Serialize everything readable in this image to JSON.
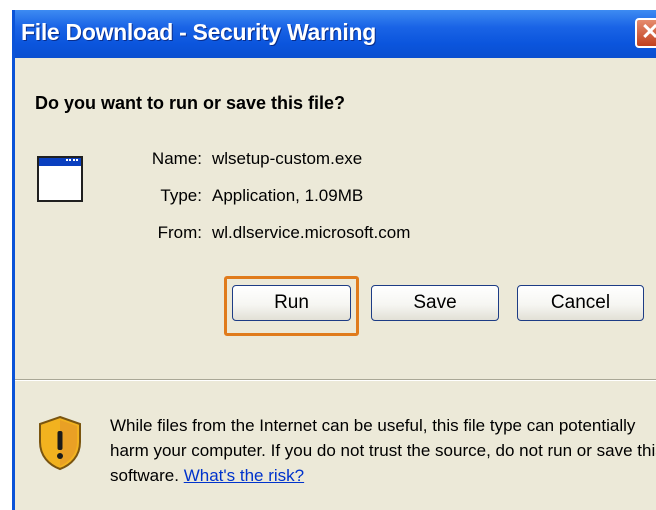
{
  "window": {
    "title": "File Download - Security Warning",
    "question": "Do you want to run or save this file?"
  },
  "file": {
    "name_label": "Name:",
    "name_value": "wlsetup-custom.exe",
    "type_label": "Type:",
    "type_value": "Application, 1.09MB",
    "from_label": "From:",
    "from_value": "wl.dlservice.microsoft.com"
  },
  "buttons": {
    "run": "Run",
    "save": "Save",
    "cancel": "Cancel"
  },
  "warning": {
    "text": "While files from the Internet can be useful, this file type can potentially harm your computer. If you do not trust the source, do not run or save this software.",
    "link": "What's the risk?"
  },
  "colors": {
    "titlebar": "#0b55dd",
    "dialog_bg": "#ece9d8",
    "highlight": "#e07b1c",
    "link": "#0033cc"
  },
  "icons": {
    "file": "application-window-icon",
    "warning": "security-shield-icon",
    "close": "close-icon"
  }
}
